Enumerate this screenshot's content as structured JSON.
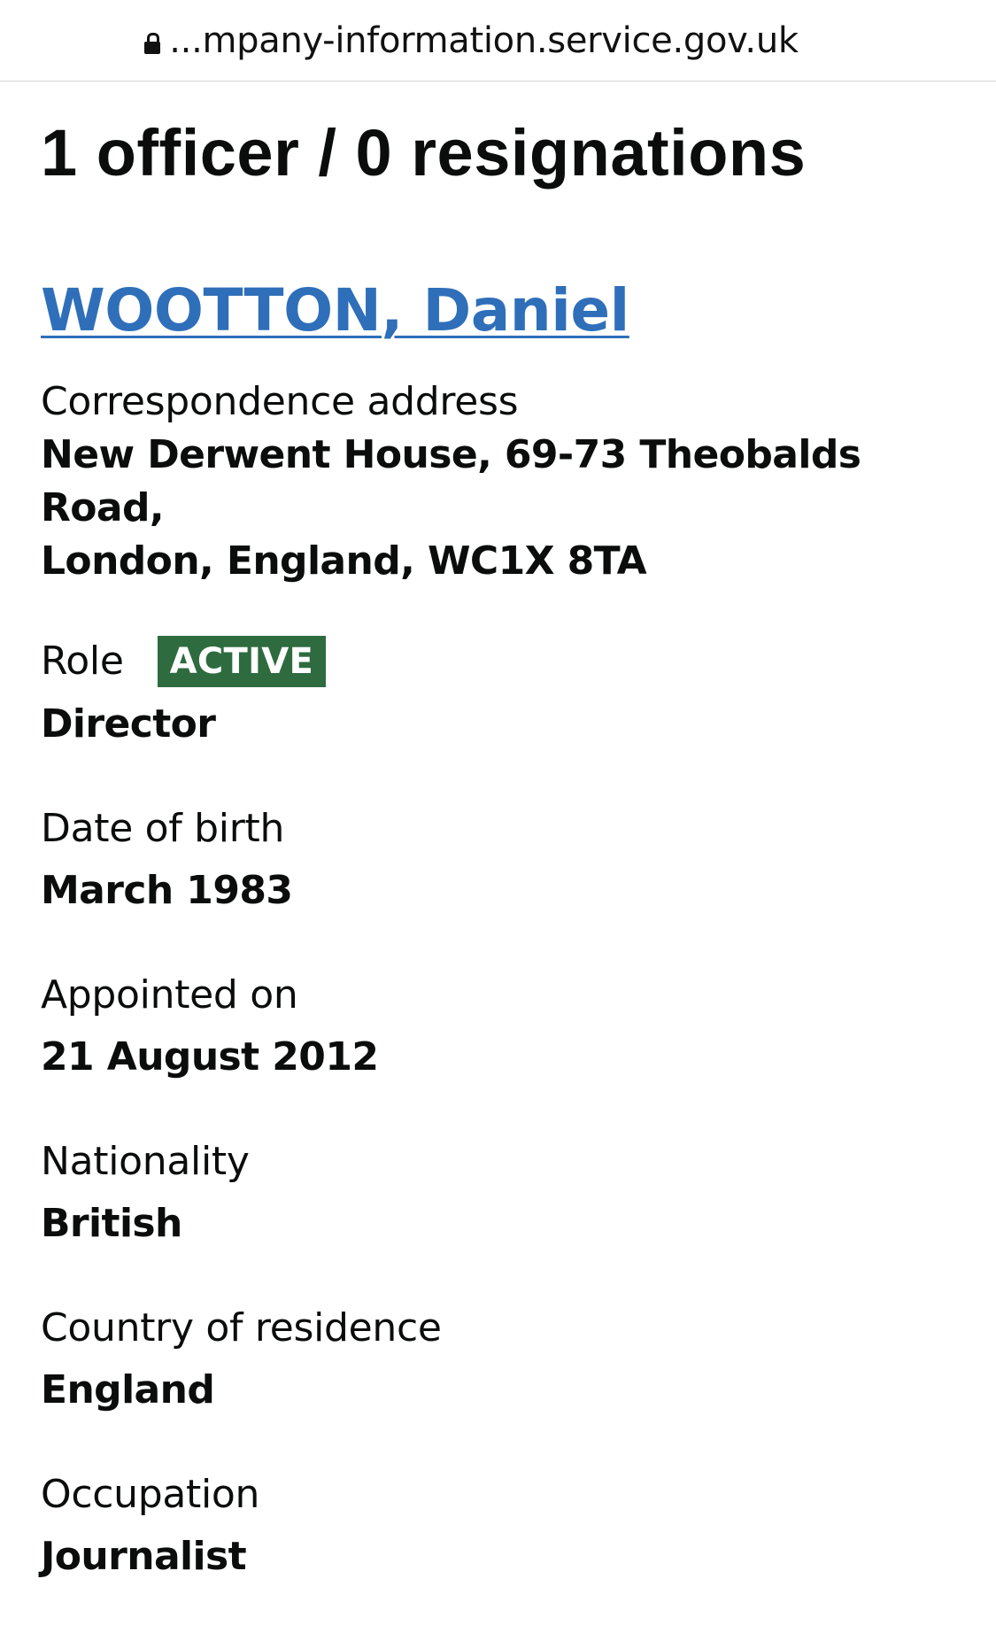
{
  "browser": {
    "url": "...mpany-information.service.gov.uk",
    "lock_icon": "lock-icon"
  },
  "page": {
    "title": "1 officer / 0 resignations"
  },
  "officer": {
    "name": "WOOTTON, Daniel",
    "correspondence_address_label": "Correspondence address",
    "correspondence_address_line1": "New Derwent House, 69-73 Theobalds Road,",
    "correspondence_address_line2": "London, England, WC1X 8TA",
    "role_label": "Role",
    "role_status": "ACTIVE",
    "role_status_color": "#2e6b3f",
    "role": "Director",
    "dob_label": "Date of birth",
    "dob": "March 1983",
    "appointed_label": "Appointed on",
    "appointed": "21 August 2012",
    "nationality_label": "Nationality",
    "nationality": "British",
    "residence_label": "Country of residence",
    "residence": "England",
    "occupation_label": "Occupation",
    "occupation": "Journalist"
  },
  "colors": {
    "link": "#2f6fba",
    "text": "#0b0c0c"
  }
}
